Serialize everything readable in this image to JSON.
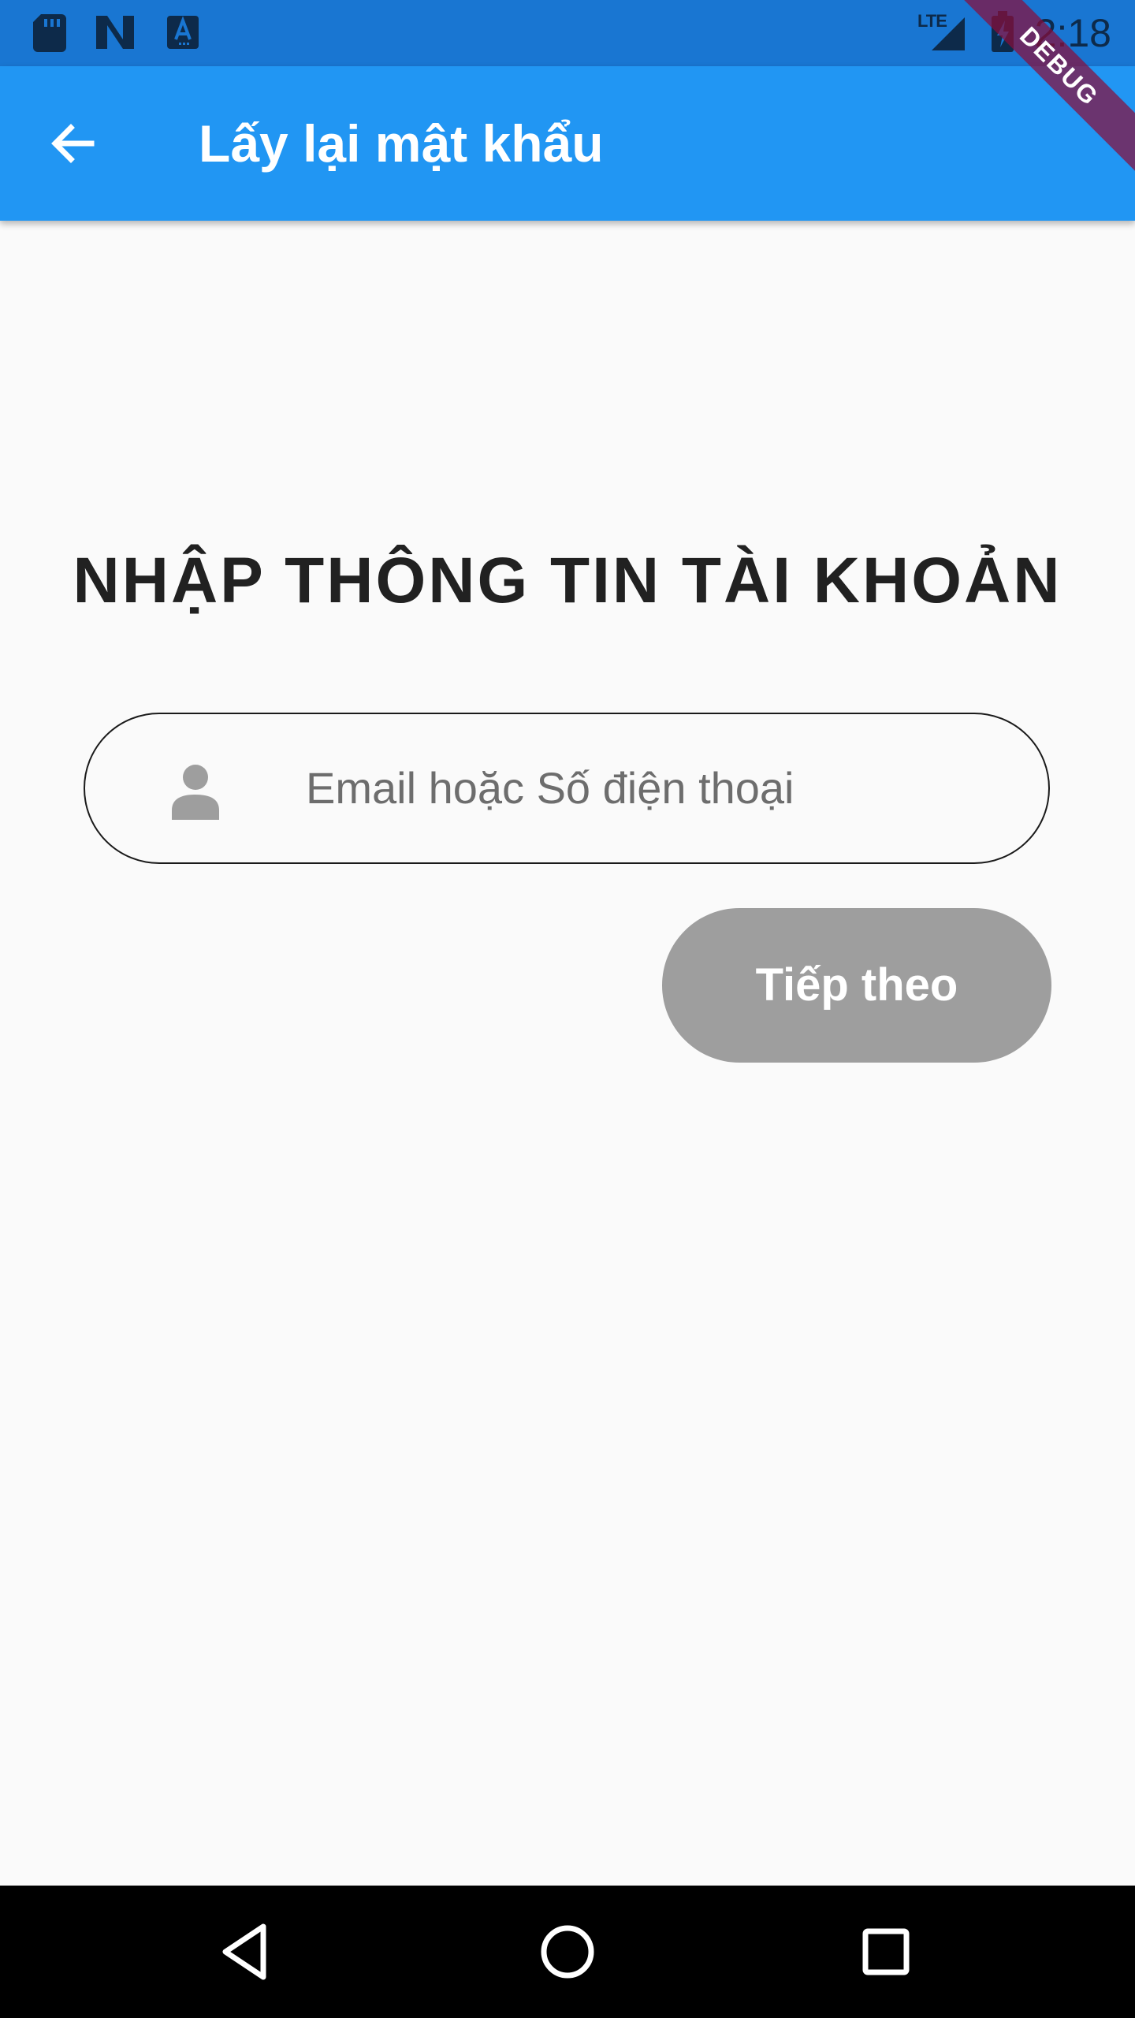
{
  "status_bar": {
    "time": "2:18",
    "network_label": "LTE",
    "left_icons": [
      "sd-card-icon",
      "n-logo-icon",
      "a-notification-icon"
    ],
    "right_icons": [
      "lte-signal-icon",
      "battery-charging-icon"
    ]
  },
  "app_bar": {
    "title": "Lấy lại mật khẩu",
    "back_icon": "arrow-back-icon",
    "color": "#2196f3"
  },
  "debug_banner": {
    "label": "DEBUG"
  },
  "main": {
    "heading": "NHẬP THÔNG TIN TÀI KHOẢN",
    "account_field": {
      "icon": "person-icon",
      "placeholder": "Email hoặc Số điện thoại",
      "value": ""
    },
    "next_button": {
      "label": "Tiếp theo",
      "color": "#9e9e9e"
    }
  },
  "nav_bar": {
    "buttons": [
      "back-triangle-icon",
      "home-circle-icon",
      "recents-square-icon"
    ]
  }
}
